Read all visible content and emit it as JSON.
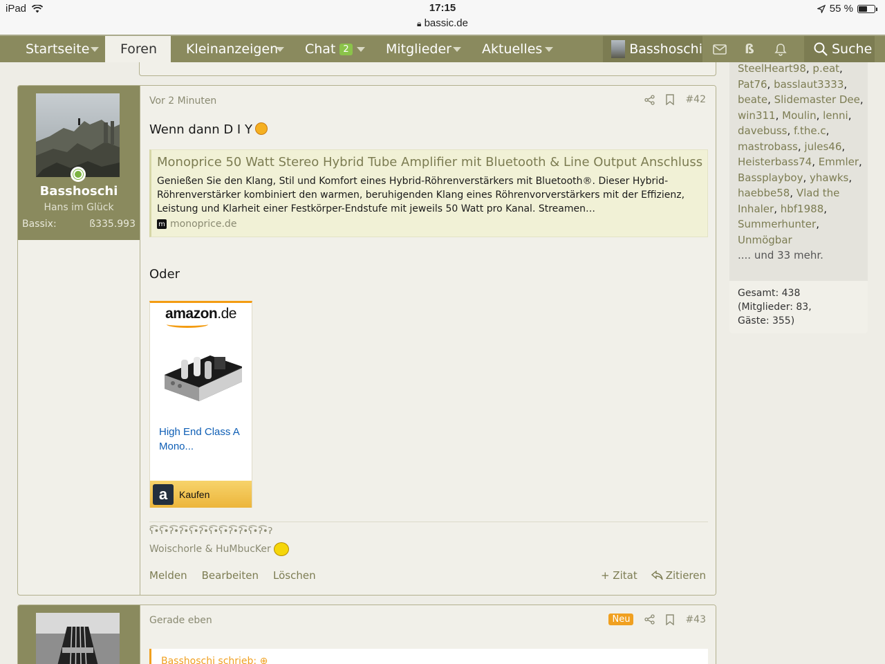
{
  "status": {
    "device": "iPad",
    "time": "17:15",
    "url": "bassic.de",
    "battery": "55 %",
    "battery_level": 0.55
  },
  "nav": {
    "items": [
      {
        "label": "Startseite"
      },
      {
        "label": "Foren"
      },
      {
        "label": "Kleinanzeigen"
      },
      {
        "label": "Chat",
        "badge": "2"
      },
      {
        "label": "Mitglieder"
      },
      {
        "label": "Aktuelles"
      }
    ],
    "user": "Basshoschi",
    "search": "Suche",
    "icons": [
      "envelope-icon",
      "bassix-icon",
      "bell-icon",
      "search-icon"
    ],
    "bassix_glyph": "ß"
  },
  "post42": {
    "author": "Basshoschi",
    "title": "Hans im Glück",
    "stat_label": "Bassix:",
    "stat_value": "ß335.993",
    "time": "Vor 2 Minuten",
    "number": "#42",
    "text1": "Wenn dann D I Y",
    "unfurl": {
      "title": "Monoprice 50 Watt Stereo Hybrid Tube Amplifier mit Bluetooth & Line Output Anschluss",
      "desc": "Genießen Sie den Klang, Stil und Komfort eines Hybrid-Röhrenverstärkers mit Bluetooth®. Dieser Hybrid-Röhrenverstärker kombiniert den warmen, beruhigenden Klang eines Röhrenvorverstärkers mit der Effizienz, Leistung und Klarheit einer Festkörper-Endstufe mit jeweils 50 Watt pro Kanal. Streamen…",
      "site": "monoprice.de",
      "favicon": "m"
    },
    "text2": "Oder",
    "amazon": {
      "logo": "amazon",
      "logo_tld": ".de",
      "product": "High End Class A Mono...",
      "buy_icon": "a",
      "buy": "Kaufen"
    },
    "signature1": "ʕ͡•ʕ͡•ʔ͡•ʔ͡•ʕ͡•ʔ͡•ʕ͡•ʕ͡•ʔ͡•ʔ͡•ʕ͡•ʔ͡•ʔ",
    "signature2": "Woischorle & HuMbucKer",
    "actions": {
      "report": "Melden",
      "edit": "Bearbeiten",
      "delete": "Löschen",
      "quote_plus": "+ Zitat",
      "reply": "Zitieren"
    }
  },
  "post43": {
    "time": "Gerade eben",
    "badge": "Neu",
    "number": "#43",
    "quote_head": "Basshoschi schrieb:"
  },
  "sidebar": {
    "names": [
      "SteelHeart98",
      "p.eat",
      "Pat76",
      "basslaut3333",
      "beate",
      "Slidemaster Dee",
      "win311",
      "Moulin",
      "lenni",
      "davebuss",
      "f.the.c",
      "mastrobass",
      "jules46",
      "Heisterbass74",
      "Emmler",
      "Bassplayboy",
      "yhawks",
      "haebbe58",
      "Vlad the Inhaler",
      "hbf1988",
      "Summerhunter",
      "Unmögbar"
    ],
    "more": ".... und 33 mehr.",
    "total_line1": "Gesamt: 438",
    "total_line2": "(Mitglieder: 83,",
    "total_line3": "Gäste: 355)"
  }
}
